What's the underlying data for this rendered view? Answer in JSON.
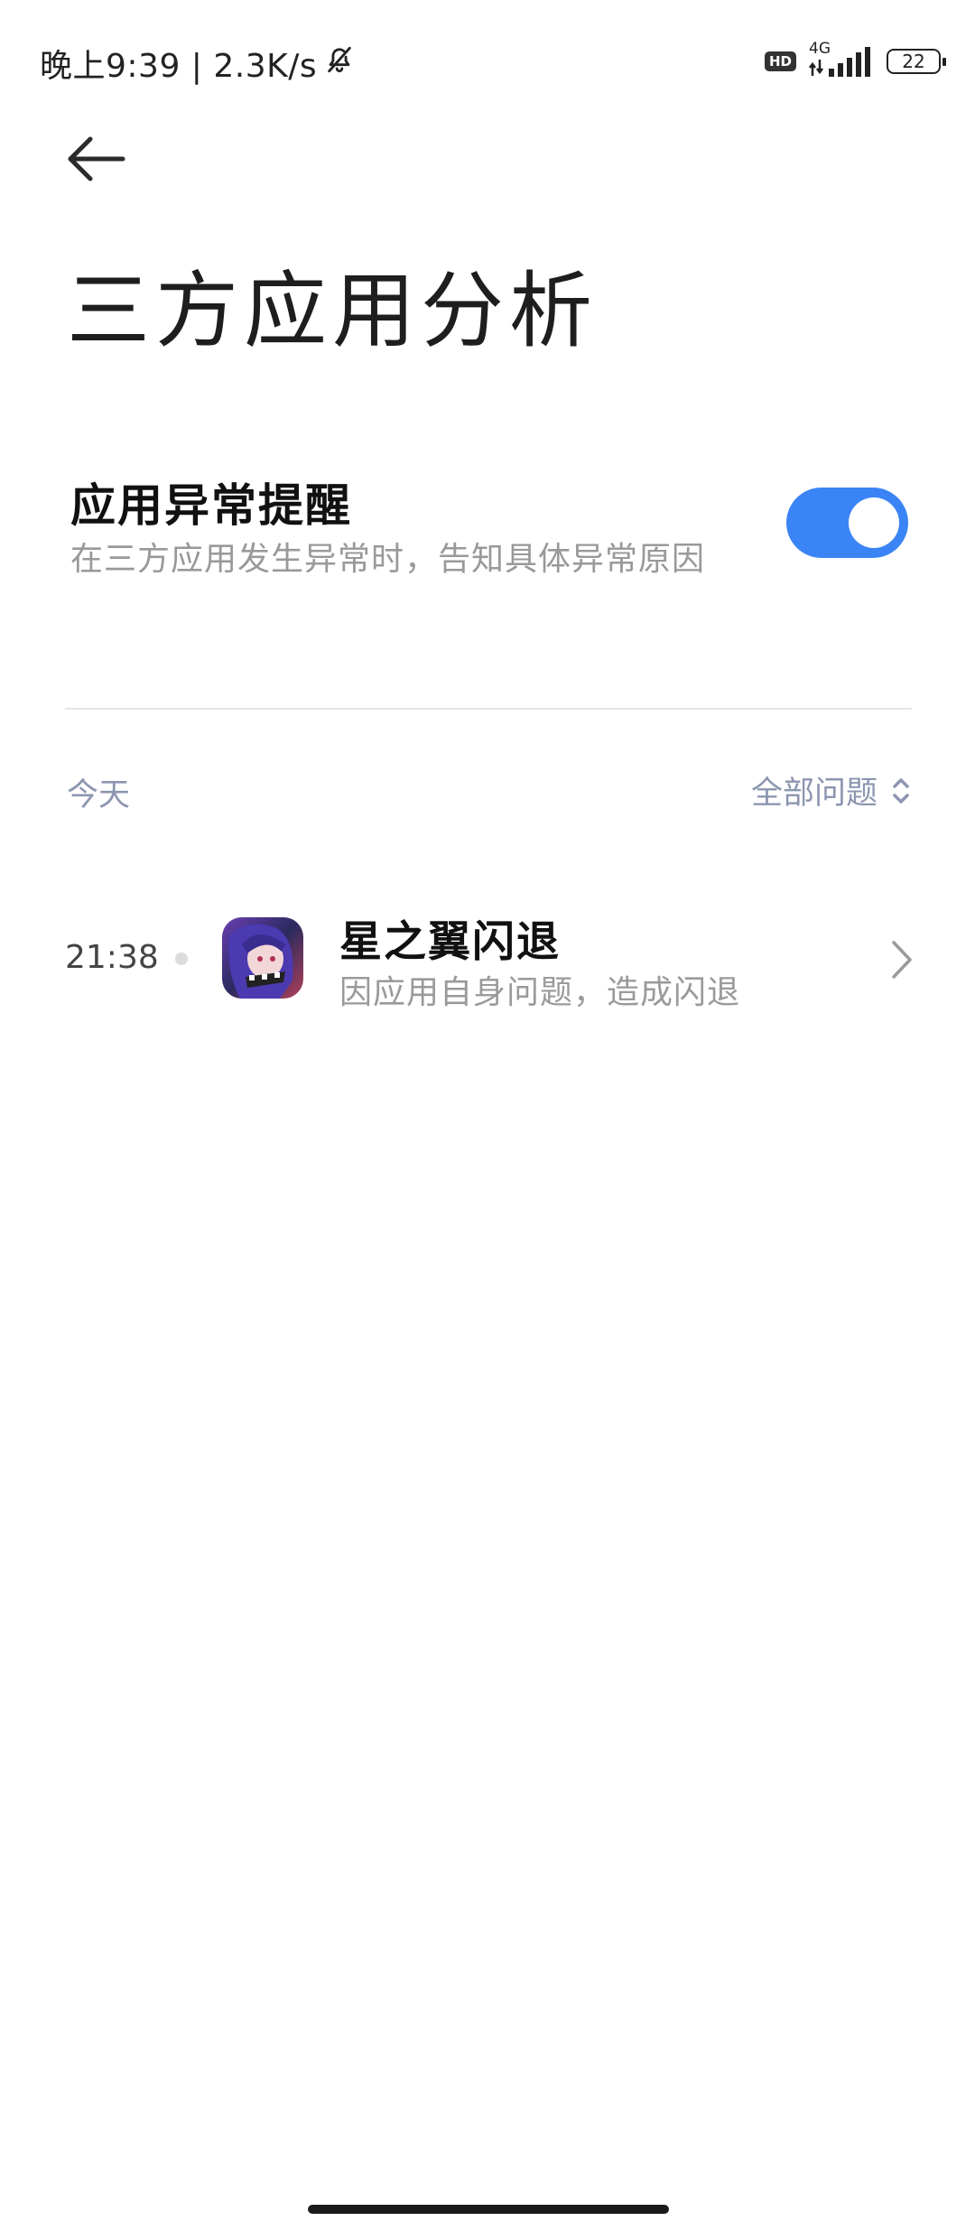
{
  "status_bar": {
    "time_text": "晚上9:39 | 2.3K/s",
    "hd_label": "HD",
    "network_label": "4G",
    "battery_level": "22"
  },
  "header": {
    "title": "三方应用分析"
  },
  "setting": {
    "title": "应用异常提醒",
    "description": "在三方应用发生异常时，告知具体异常原因",
    "enabled": true,
    "accent_color": "#3a84f5"
  },
  "section": {
    "date_label": "今天",
    "filter_label": "全部问题"
  },
  "records": [
    {
      "time": "21:38",
      "title": "星之翼闪退",
      "subtitle": "因应用自身问题，造成闪退",
      "icon": "app-icon"
    }
  ]
}
